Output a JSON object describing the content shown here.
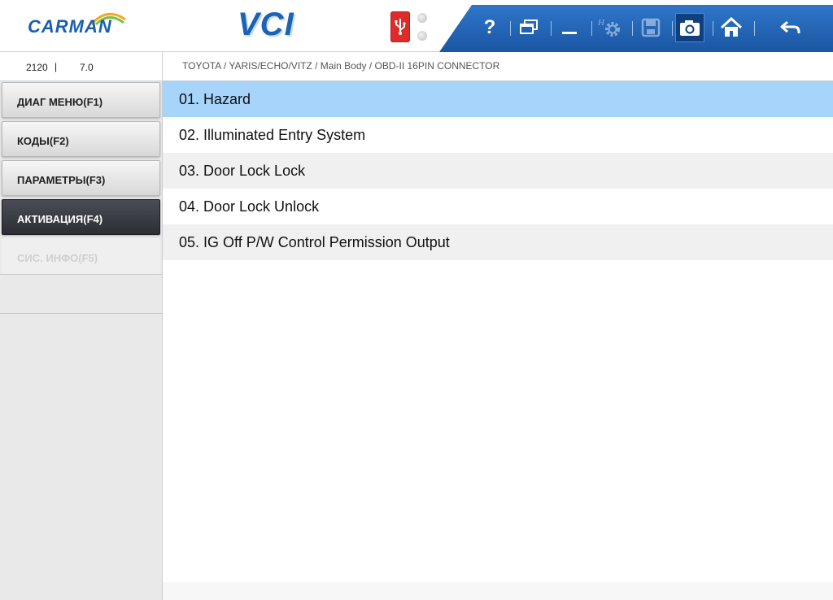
{
  "header": {
    "logo_text": "CARMAN",
    "app_title": "VCI",
    "toolbar": [
      {
        "name": "help-button",
        "icon": "question-icon",
        "label": "?"
      },
      {
        "name": "window-mode-button",
        "icon": "window-icon"
      },
      {
        "name": "minimize-button",
        "icon": "minimize-icon"
      },
      {
        "name": "settings-button",
        "icon": "gear-icon",
        "disabled": true
      },
      {
        "name": "save-button",
        "icon": "floppy-icon",
        "disabled": true
      },
      {
        "name": "screenshot-button",
        "icon": "camera-icon",
        "active": true
      },
      {
        "name": "home-button",
        "icon": "home-icon"
      },
      {
        "name": "back-button",
        "icon": "back-arrow-icon"
      }
    ],
    "colors": {
      "brand_blue": "#1b63b8",
      "toolbar_blue": "#1a56a3",
      "usb_red": "#e02b2b"
    }
  },
  "info": {
    "code": "2120",
    "separator": "|",
    "version": "7.0"
  },
  "breadcrumb": "TOYOTA / YARIS/ECHO/VITZ / Main Body / OBD-II 16PIN CONNECTOR",
  "sidebar": {
    "items": [
      {
        "label": "ДИАГ МЕНЮ(F1)",
        "state": "normal"
      },
      {
        "label": "КОДЫ(F2)",
        "state": "normal"
      },
      {
        "label": "ПАРАМЕТРЫ(F3)",
        "state": "normal"
      },
      {
        "label": "АКТИВАЦИЯ(F4)",
        "state": "active"
      },
      {
        "label": "СИС. ИНФО(F5)",
        "state": "disabled"
      }
    ]
  },
  "main": {
    "items": [
      {
        "label": "01. Hazard",
        "selected": true
      },
      {
        "label": "02. Illuminated Entry System"
      },
      {
        "label": "03. Door Lock Lock"
      },
      {
        "label": "04. Door Lock Unlock"
      },
      {
        "label": "05. IG Off P/W Control Permission Output"
      }
    ],
    "colors": {
      "selected_row": "#a6d4fa",
      "alt_row": "#f0f0f0"
    }
  }
}
